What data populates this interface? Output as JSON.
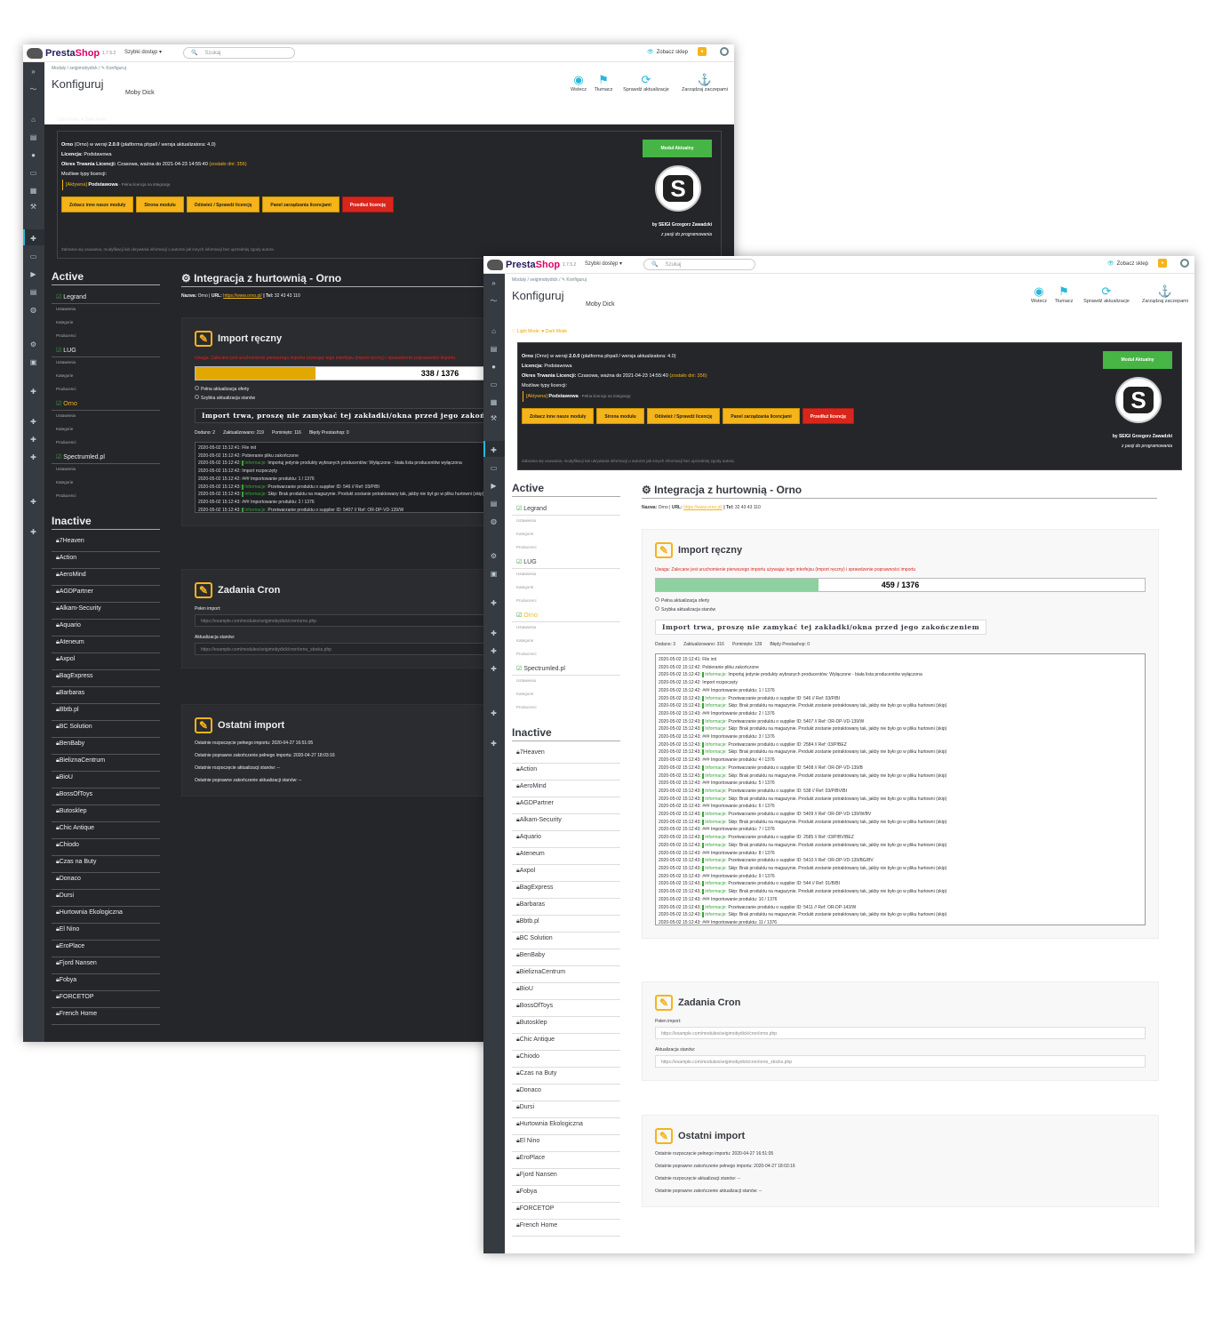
{
  "header": {
    "logo_part1": "Presta",
    "logo_part2": "Shop",
    "version": "1.7.5.2",
    "quick_access": "Szybki dostęp ▾",
    "search_placeholder": "Szukaj",
    "view_shop": "Zobacz sklep"
  },
  "page": {
    "breadcrumb": "Moduły  /  seigimobydick  /  ✎ Konfiguruj",
    "title": "Konfiguruj",
    "module_name": "Moby Dick"
  },
  "toolbar": {
    "back": "Wstecz",
    "translate": "Tłumacz",
    "check_updates": "Sprawdź aktualizacje",
    "manage_hooks": "Zarządzaj zaczepami"
  },
  "modes": {
    "light": "♡ Light Mode",
    "dark": "♥ Dark Mode"
  },
  "license": {
    "line1_name": "Orno",
    "line1_rest": " (Orno) w wersji ",
    "line1_version": "2.0.0",
    "line1_tail": " (platforma phpall / wersja aktualizatora: 4.0)",
    "license_label": "Licencja:",
    "license_value": " Podstawowa",
    "period_label": "Okres Trwania Licencji:",
    "period_value": " Czasowa, ważna do 2021-04-23 14:55:40 ",
    "period_left": "(zostało dni: 356)",
    "types_label": "Możliwe typy licencji:",
    "type_active": "[Aktywna]",
    "type_name": " Podstawowa",
    "type_desc": " - Pełna licencja na integrację",
    "btn_other": "Zobacz inne nasze moduły",
    "btn_page": "Strona modułu",
    "btn_refresh": "Odśwież / Sprawdź licencję",
    "btn_panel": "Panel zarządzania licencjami",
    "btn_extend": "Przedłuż licencję",
    "module_status": "Moduł Aktualny",
    "author": "by SEIGI Grzegorz Zawadzki",
    "motto": "z pasji do programowania",
    "disclaimer": "Zabrania się usuwania, modyfikacji lub ukrywania informacji o autorze jak innych informacji bez uprzedniej zgody autora."
  },
  "active": {
    "title": "Active",
    "modules": [
      {
        "name": "Legrand",
        "subs": [
          "Ustawienia",
          "Kategorie",
          "Producenci"
        ]
      },
      {
        "name": "LUG",
        "subs": [
          "Ustawienia",
          "Kategorie",
          "Producenci"
        ]
      },
      {
        "name": "Orno",
        "subs": [
          "Ustawienia",
          "Kategorie",
          "Producenci"
        ]
      },
      {
        "name": "Spectrumled.pl",
        "subs": [
          "Ustawienia",
          "Kategorie",
          "Producenci"
        ]
      }
    ]
  },
  "inactive": {
    "title": "Inactive",
    "modules": [
      "7Heaven",
      "Action",
      "AeroMind",
      "AGDPartner",
      "Alkam-Security",
      "Aquario",
      "Ateneum",
      "Axpol",
      "BagExpress",
      "Barbaras",
      "Bbtb.pl",
      "BC Solution",
      "BenBaby",
      "BieliznaCentrum",
      "BioU",
      "BossOfToys",
      "Butosklep",
      "Chic Antique",
      "Chiodo",
      "Czas na Buty",
      "Donaco",
      "Dursi",
      "Hurtownia Ekologiczna",
      "El Nino",
      "EroPlace",
      "Fjord Nansen",
      "Fobya",
      "FORCETOP",
      "French Home"
    ]
  },
  "integration": {
    "title": "Integracja z hurtownią - Orno",
    "name_label": "Nazwa:",
    "name_value": " Orno | ",
    "url_label": "URL:",
    "url_value": "https://www.orno.pl/",
    "tel_label": " | Tel:",
    "tel_value": " 32 43 43 110"
  },
  "import": {
    "title": "Import ręczny",
    "warning": "Uwaga: Zalecane jest uruchomienie pierwszego importu używając tego interfejsu (import ręczny) i sprawdzenie poprawności importu",
    "opt_full": "Pełna aktualizacja oferty",
    "opt_quick": "Szybka aktualizacja stanów",
    "wait": "Import trwa, proszę nie zamykać tej zakładki/okna przed jego zakończeniem",
    "dark": {
      "progress_text": "338 / 1376",
      "progress": 0.2456,
      "added": "Dodano: 2",
      "updated": "Zaktualizowano: 219",
      "skipped": "Pominięto: 116",
      "errors": "Błędy Prestashop: 0"
    },
    "light": {
      "progress_text": "459 / 1376",
      "progress": 0.3336,
      "added": "Dodano: 3",
      "updated": "Zaktualizowano: 316",
      "skipped": "Pominięto: 139",
      "errors": "Błędy Prestashop: 0"
    },
    "log_dark": [
      [
        "2020-05-02 15:12:41: File init",
        ""
      ],
      [
        "2020-05-02 15:12:42: Pobieranie pliku zakończone",
        ""
      ],
      [
        "2020-05-02 15:12:42: ",
        "Informacje:",
        " Importuj jedynie produkty wybranych producentów: Wyłączone - biała lista producentów wyłączona"
      ],
      [
        "2020-05-02 15:12:42: Import rozpoczęty",
        ""
      ],
      [
        "2020-05-02 15:12:42: ### Importowanie produktu: 1 / 1376",
        ""
      ],
      [
        "2020-05-02 15:12:43: ",
        "Informacje:",
        " Przetwarzanie produktu o supplier ID: 546 // Ref: 03/P/BI"
      ],
      [
        "2020-05-02 15:12:43: ",
        "Informacje:",
        " Skip: Brak produktu na magazynie. Produkt zostanie potraktowany tak, jakby nie był go w pliku hurtowni (skip)"
      ],
      [
        "2020-05-02 15:12:43: ### Importowanie produktu: 2 / 1376",
        ""
      ],
      [
        "2020-05-02 15:12:43: ",
        "Informacje:",
        " Przetwarzanie produktu o supplier ID: 5407 // Ref: OR-DP-VD-139/W"
      ]
    ],
    "log_light": [
      [
        "2020-05-02 15:12:41: File init",
        ""
      ],
      [
        "2020-05-02 15:12:42: Pobieranie pliku zakończone",
        ""
      ],
      [
        "2020-05-02 15:12:42: ",
        "Informacje:",
        " Importuj jedynie produkty wybranych producentów: Wyłączone - biała lista producentów wyłączona"
      ],
      [
        "2020-05-02 15:12:42: Import rozpoczęty",
        ""
      ],
      [
        "2020-05-02 15:12:42: ### Importowanie produktu: 1 / 1376",
        ""
      ],
      [
        "2020-05-02 15:12:43: ",
        "Informacje:",
        " Przetwarzanie produktu o supplier ID: 546 // Ref: 03/P/BI"
      ],
      [
        "2020-05-02 15:12:43: ",
        "Informacje:",
        " Skip: Brak produktu na magazynie. Produkt zostanie potraktowany tak, jakby nie było go w pliku hurtowni (skip)"
      ],
      [
        "2020-05-02 15:12:43: ### Importowanie produktu: 2 / 1376",
        ""
      ],
      [
        "2020-05-02 15:12:43: ",
        "Informacje:",
        " Przetwarzanie produktu o supplier ID: 5407 // Ref: OR-DP-VD-139/W"
      ],
      [
        "2020-05-02 15:12:43: ",
        "Informacje:",
        " Skip: Brak produktu na magazynie. Produkt zostanie potraktowany tak, jakby nie było go w pliku hurtowni (skip)"
      ],
      [
        "2020-05-02 15:12:43: ### Importowanie produktu: 3 / 1376",
        ""
      ],
      [
        "2020-05-02 15:12:43: ",
        "Informacje:",
        " Przetwarzanie produktu o supplier ID: 2584 // Ref: 03/P/BEZ"
      ],
      [
        "2020-05-02 15:12:43: ",
        "Informacje:",
        " Skip: Brak produktu na magazynie. Produkt zostanie potraktowany tak, jakby nie było go w pliku hurtowni (skip)"
      ],
      [
        "2020-05-02 15:12:43: ### Importowanie produktu: 4 / 1376",
        ""
      ],
      [
        "2020-05-02 15:12:43: ",
        "Informacje:",
        " Przetwarzanie produktu o supplier ID: 5408 // Ref: OR-DP-VD-139/B"
      ],
      [
        "2020-05-02 15:12:43: ",
        "Informacje:",
        " Skip: Brak produktu na magazynie. Produkt zostanie potraktowany tak, jakby nie było go w pliku hurtowni (skip)"
      ],
      [
        "2020-05-02 15:12:43: ### Importowanie produktu: 5 / 1376",
        ""
      ],
      [
        "2020-05-02 15:12:43: ",
        "Informacje:",
        " Przetwarzanie produktu o supplier ID: 538 // Ref: 03/P/BV/BI"
      ],
      [
        "2020-05-02 15:12:43: ",
        "Informacje:",
        " Skip: Brak produktu na magazynie. Produkt zostanie potraktowany tak, jakby nie było go w pliku hurtowni (skip)"
      ],
      [
        "2020-05-02 15:12:43: ### Importowanie produktu: 6 / 1376",
        ""
      ],
      [
        "2020-05-02 15:12:43: ",
        "Informacje:",
        " Przetwarzanie produktu o supplier ID: 5409 // Ref: OR-DP-VD-139/W/BV"
      ],
      [
        "2020-05-02 15:12:43: ",
        "Informacje:",
        " Skip: Brak produktu na magazynie. Produkt zostanie potraktowany tak, jakby nie było go w pliku hurtowni (skip)"
      ],
      [
        "2020-05-02 15:12:43: ### Importowanie produktu: 7 / 1376",
        ""
      ],
      [
        "2020-05-02 15:12:43: ",
        "Informacje:",
        " Przetwarzanie produktu o supplier ID: 2585 // Ref: 03/P/BV/BEZ"
      ],
      [
        "2020-05-02 15:12:43: ",
        "Informacje:",
        " Skip: Brak produktu na magazynie. Produkt zostanie potraktowany tak, jakby nie było go w pliku hurtowni (skip)"
      ],
      [
        "2020-05-02 15:12:43: ### Importowanie produktu: 8 / 1376",
        ""
      ],
      [
        "2020-05-02 15:12:43: ",
        "Informacje:",
        " Przetwarzanie produktu o supplier ID: 5410 // Ref: OR-DP-VD-139/BG/BV"
      ],
      [
        "2020-05-02 15:12:43: ",
        "Informacje:",
        " Skip: Brak produktu na magazynie. Produkt zostanie potraktowany tak, jakby nie było go w pliku hurtowni (skip)"
      ],
      [
        "2020-05-02 15:12:43: ### Importowanie produktu: 9 / 1376",
        ""
      ],
      [
        "2020-05-02 15:12:43: ",
        "Informacje:",
        " Przetwarzanie produktu o supplier ID: 544 // Ref: 01/B/BI"
      ],
      [
        "2020-05-02 15:12:43: ",
        "Informacje:",
        " Skip: Brak produktu na magazynie. Produkt zostanie potraktowany tak, jakby nie było go w pliku hurtowni (skip)"
      ],
      [
        "2020-05-02 15:12:43: ### Importowanie produktu: 10 / 1376",
        ""
      ],
      [
        "2020-05-02 15:12:43: ",
        "Informacje:",
        " Przetwarzanie produktu o supplier ID: 5411 // Ref: OR-DP-143/W"
      ],
      [
        "2020-05-02 15:12:43: ",
        "Informacje:",
        " Skip: Brak produktu na magazynie. Produkt zostanie potraktowany tak, jakby nie było go w pliku hurtowni (skip)"
      ],
      [
        "2020-05-02 15:12:43: ### Importowanie produktu: 11 / 1376",
        ""
      ]
    ]
  },
  "cron": {
    "title": "Zadania Cron",
    "full_label": "Pełen import:",
    "full_url": "https://example.com/modules/seigimobydick/cron/orno.php",
    "stock_label": "Aktualizacja stanów:",
    "stock_url": "https://example.com/modules/seigimobydick/cron/orno_stocks.php"
  },
  "last": {
    "title": "Ostatni import",
    "l1": "Ostatnie rozpoczęcie pełnego importu: 2020-04-27 16:51:05",
    "l2": "Ostatnie poprawne zakończenie pełnego importu: 2020-04-27 18:03:16",
    "l3": "Ostatnie rozpoczęcie aktualizacji stanów: --",
    "l4": "Ostatnie poprawne zakończenie aktualizacji stanów: --"
  },
  "colors": {
    "accent": "#25b9d7",
    "yellow": "#f4b41a",
    "red": "#d9261c",
    "green": "#46b545",
    "progress_dark": "#e0a800",
    "progress_light": "#8fd19e"
  }
}
